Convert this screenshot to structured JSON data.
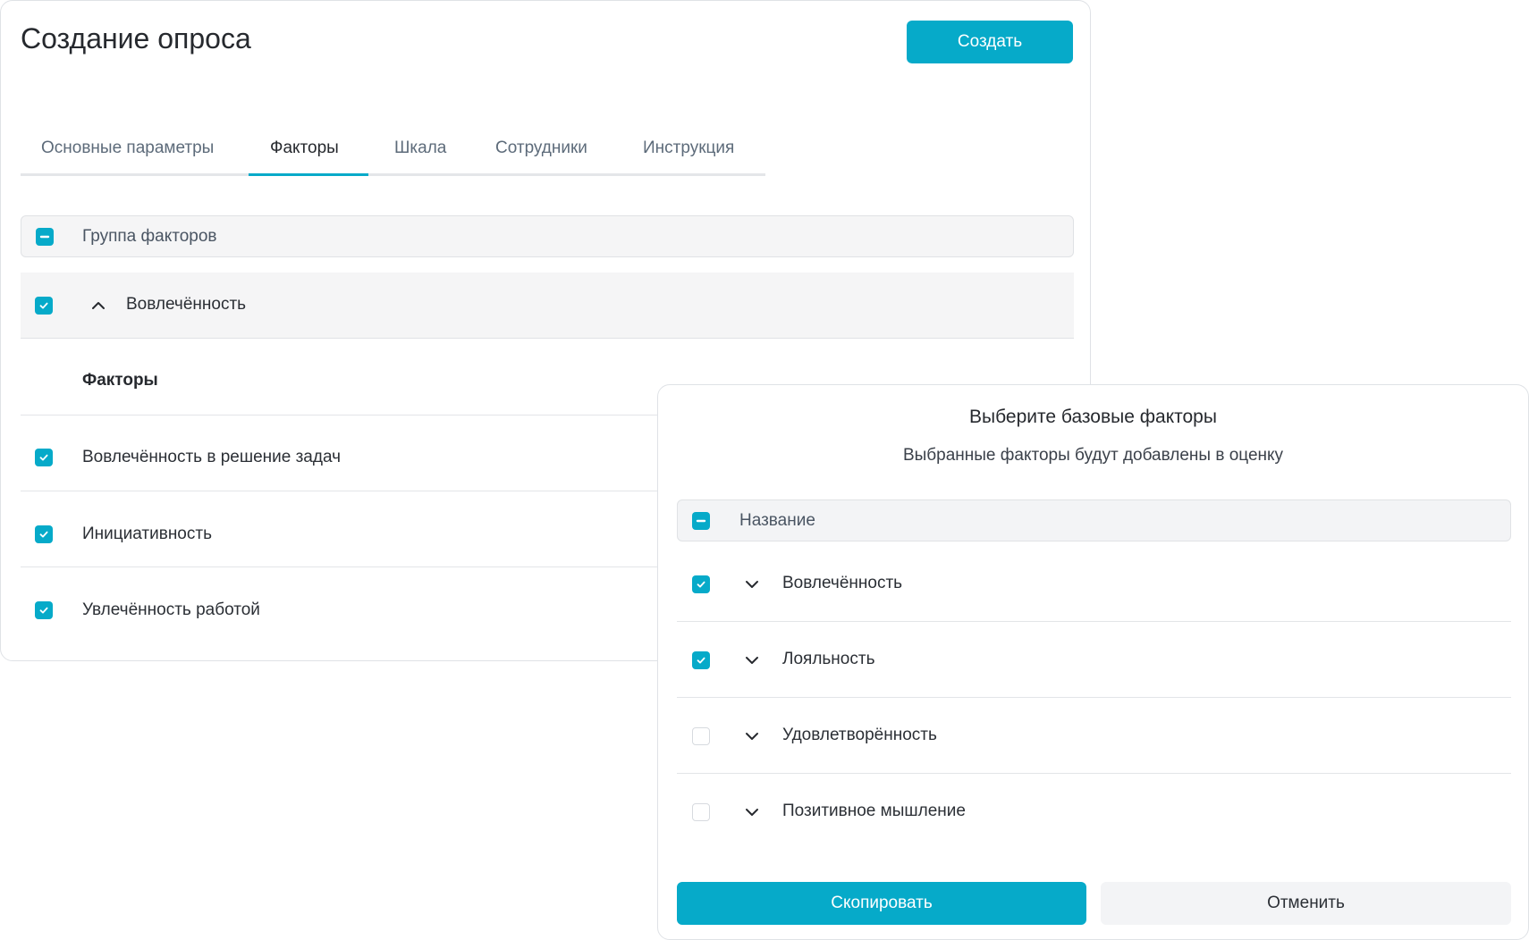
{
  "page": {
    "title": "Создание опроса",
    "create_label": "Создать"
  },
  "tabs": [
    {
      "label": "Основные параметры",
      "active": false
    },
    {
      "label": "Факторы",
      "active": true
    },
    {
      "label": "Шкала",
      "active": false
    },
    {
      "label": "Сотрудники",
      "active": false
    },
    {
      "label": "Инструкция",
      "active": false
    }
  ],
  "factor_group": {
    "header_label": "Группа факторов",
    "header_checkbox": "indeterminate",
    "category": {
      "label": "Вовлечённость",
      "checked": true,
      "expanded": true
    },
    "factors_title": "Факторы",
    "factors": [
      {
        "label": "Вовлечённость в решение задач",
        "checked": true
      },
      {
        "label": "Инициативность",
        "checked": true
      },
      {
        "label": "Увлечённость работой",
        "checked": true
      }
    ]
  },
  "modal": {
    "title": "Выберите базовые факторы",
    "subtitle": "Выбранные факторы будут добавлены в оценку",
    "header_label": "Название",
    "header_checkbox": "indeterminate",
    "rows": [
      {
        "label": "Вовлечённость",
        "checked": true
      },
      {
        "label": "Лояльность",
        "checked": true
      },
      {
        "label": "Удовлетворённость",
        "checked": false
      },
      {
        "label": "Позитивное мышление",
        "checked": false
      }
    ],
    "copy_label": "Скопировать",
    "cancel_label": "Отменить"
  },
  "colors": {
    "accent": "#06aac9",
    "row_background": "#f5f5f6",
    "border": "#dfe2e6"
  },
  "icons": [
    "check-icon",
    "minus-icon",
    "chevron-up-icon",
    "chevron-down-icon"
  ]
}
